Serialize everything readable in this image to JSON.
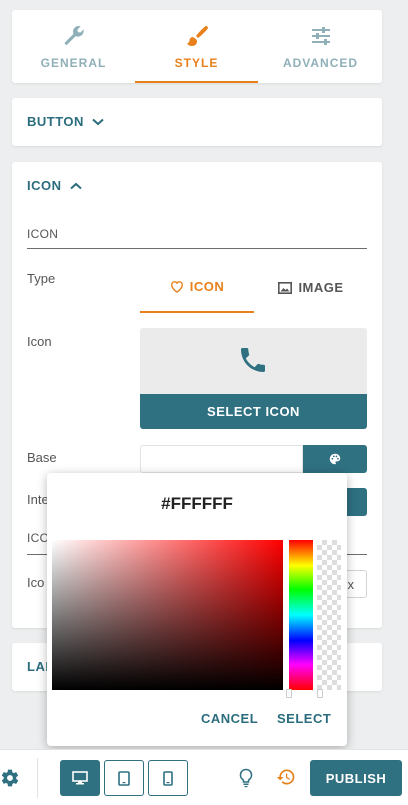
{
  "tabs": [
    {
      "label": "GENERAL",
      "icon": "wrench-icon",
      "active": false
    },
    {
      "label": "STYLE",
      "icon": "brush-icon",
      "active": true
    },
    {
      "label": "ADVANCED",
      "icon": "sliders-icon",
      "active": false
    }
  ],
  "button_section": {
    "title": "BUTTON"
  },
  "icon_section": {
    "title": "ICON",
    "subheading": "ICON",
    "type_label": "Type",
    "type_options": [
      "ICON",
      "IMAGE"
    ],
    "icon_label": "Icon",
    "select_icon_label": "SELECT ICON",
    "base_label": "Base",
    "inte_label_clipped": "Inte",
    "ico_sub_clipped": "ICO",
    "ico_field_clipped": "Ico",
    "x_value": "x"
  },
  "label_section": {
    "title_clipped": "LAI"
  },
  "color_picker": {
    "hex_value": "#FFFFFF",
    "cancel_label": "CANCEL",
    "select_label": "SELECT"
  },
  "bottom_bar": {
    "publish_label": "PUBLISH"
  },
  "colors": {
    "accent": "#e8811c",
    "primary": "#2f7081",
    "tab_inactive": "#8fb0b8"
  }
}
